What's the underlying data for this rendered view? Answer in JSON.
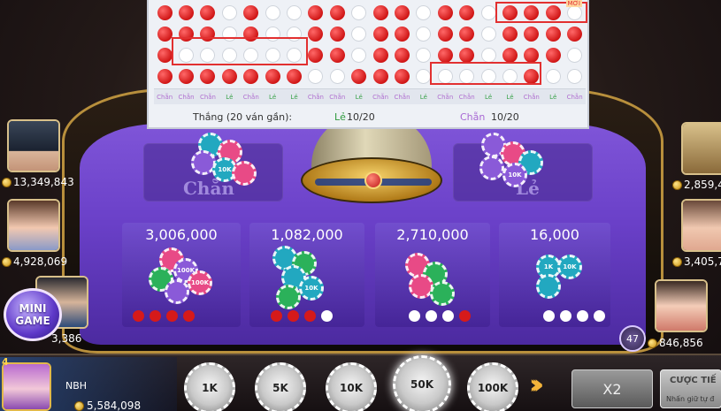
{
  "history": {
    "rows": [
      [
        "r",
        "r",
        "r",
        "w",
        "r",
        "w",
        "w",
        "r",
        "r",
        "w",
        "r",
        "r",
        "w",
        "r",
        "r",
        "w",
        "r",
        "r",
        "r",
        "w"
      ],
      [
        "r",
        "r",
        "r",
        "w",
        "r",
        "w",
        "w",
        "r",
        "r",
        "w",
        "r",
        "r",
        "w",
        "r",
        "r",
        "w",
        "r",
        "r",
        "r",
        "r"
      ],
      [
        "r",
        "w",
        "w",
        "w",
        "w",
        "w",
        "w",
        "r",
        "r",
        "w",
        "r",
        "r",
        "w",
        "r",
        "r",
        "w",
        "r",
        "r",
        "r",
        "w"
      ],
      [
        "r",
        "r",
        "r",
        "r",
        "r",
        "r",
        "r",
        "w",
        "w",
        "r",
        "r",
        "r",
        "w",
        "w",
        "w",
        "w",
        "w",
        "r",
        "w",
        "w"
      ]
    ],
    "col_labels": [
      "Chẵn",
      "Chẵn",
      "Chẵn",
      "Lẻ",
      "Chẵn",
      "Lẻ",
      "Lẻ",
      "Chẵn",
      "Chẵn",
      "Lẻ",
      "Chẵn",
      "Chẵn",
      "Lẻ",
      "Chẵn",
      "Chẵn",
      "Lẻ",
      "Lẻ",
      "Chẵn",
      "Lẻ",
      "Chẵn"
    ],
    "summary_label": "Thắng (20 ván gần):",
    "le_label": "Lẻ",
    "le_value": "10/20",
    "chan_label": "Chẵn",
    "chan_value": "10/20",
    "badge": "MỚI"
  },
  "zones_top": {
    "left_label": "Chẵn",
    "right_label": "Lẻ"
  },
  "zones": [
    {
      "amount": "3,006,000",
      "dots": [
        "r",
        "r",
        "r",
        "r"
      ]
    },
    {
      "amount": "1,082,000",
      "dots": [
        "r",
        "r",
        "r",
        "w"
      ]
    },
    {
      "amount": "2,710,000",
      "dots": [
        "w",
        "w",
        "w",
        "r"
      ]
    },
    {
      "amount": "16,000",
      "dots": [
        "w",
        "w",
        "w",
        "w"
      ]
    }
  ],
  "players_left": [
    {
      "coins": "13,349,843"
    },
    {
      "coins": "4,928,069"
    },
    {
      "coins": "3,386"
    }
  ],
  "players_right": [
    {
      "coins": "2,859,4"
    },
    {
      "coins": "3,405,7"
    },
    {
      "coins": "846,856"
    }
  ],
  "mini_game": {
    "line1": "MINI",
    "line2": "GAME"
  },
  "me": {
    "level": "4",
    "name": "NBH",
    "coins": "5,584,098"
  },
  "bet_chips": [
    "1K",
    "5K",
    "10K",
    "50K",
    "100K"
  ],
  "selected_chip": "50K",
  "buttons": {
    "x2": "X2",
    "bet_title": "CƯỢC TIẾ",
    "bet_sub": "Nhấn giữ tự đ"
  },
  "timer": "47",
  "chip_labels": {
    "k1": "1K",
    "k10": "10K",
    "k100": "100K"
  }
}
